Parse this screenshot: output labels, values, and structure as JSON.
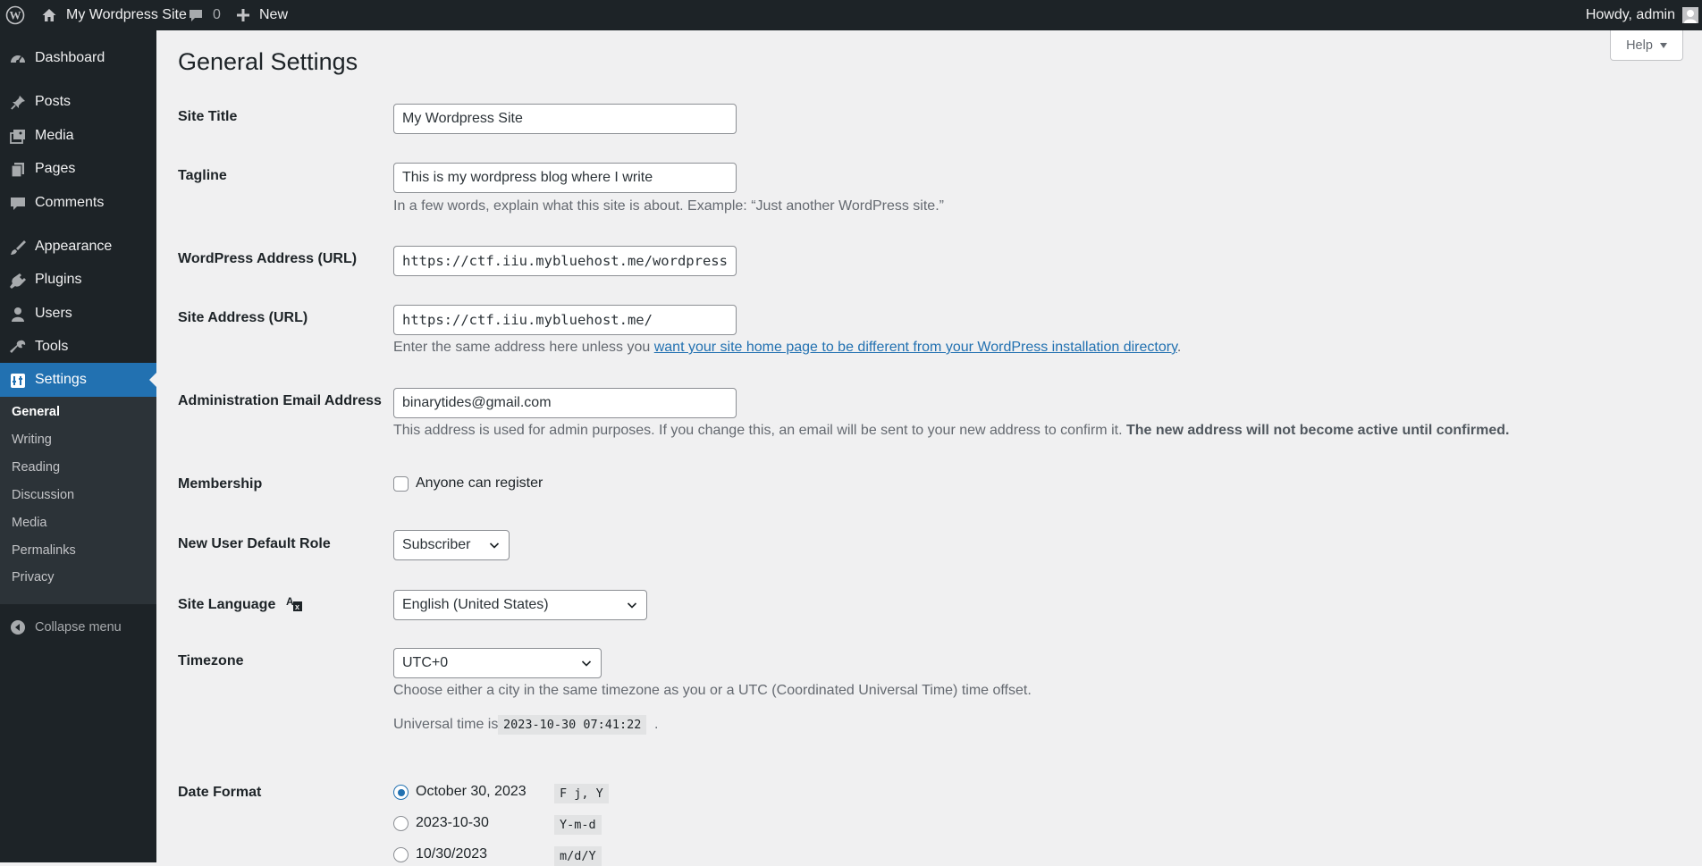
{
  "adminbar": {
    "site_name": "My Wordpress Site",
    "comments_count": "0",
    "new_label": "New",
    "howdy": "Howdy, admin"
  },
  "sidebar": {
    "items": [
      {
        "label": "Dashboard",
        "icon": "dashboard-icon"
      },
      {
        "label": "Posts",
        "icon": "pushpin-icon"
      },
      {
        "label": "Media",
        "icon": "media-icon"
      },
      {
        "label": "Pages",
        "icon": "pages-icon"
      },
      {
        "label": "Comments",
        "icon": "comments-icon"
      },
      {
        "label": "Appearance",
        "icon": "paintbrush-icon"
      },
      {
        "label": "Plugins",
        "icon": "plugin-icon"
      },
      {
        "label": "Users",
        "icon": "users-icon"
      },
      {
        "label": "Tools",
        "icon": "wrench-icon"
      },
      {
        "label": "Settings",
        "icon": "settings-icon"
      }
    ],
    "submenu": [
      "General",
      "Writing",
      "Reading",
      "Discussion",
      "Media",
      "Permalinks",
      "Privacy"
    ],
    "collapse_label": "Collapse menu",
    "accent": "#2271b1"
  },
  "help_label": "Help",
  "page_title": "General Settings",
  "settings": {
    "site_title": {
      "label": "Site Title",
      "value": "My Wordpress Site"
    },
    "tagline": {
      "label": "Tagline",
      "value": "This is my wordpress blog where I write",
      "desc": "In a few words, explain what this site is about. Example: “Just another WordPress site.”"
    },
    "wp_address": {
      "label": "WordPress Address (URL)",
      "value": "https://ctf.iiu.mybluehost.me/wordpress"
    },
    "site_address": {
      "label": "Site Address (URL)",
      "value": "https://ctf.iiu.mybluehost.me/",
      "desc_prefix": "Enter the same address here unless you ",
      "desc_link": "want your site home page to be different from your WordPress installation directory",
      "desc_suffix": "."
    },
    "admin_email": {
      "label": "Administration Email Address",
      "value": "binarytides@gmail.com",
      "desc": "This address is used for admin purposes. If you change this, an email will be sent to your new address to confirm it. ",
      "desc_bold": "The new address will not become active until confirmed."
    },
    "membership": {
      "label": "Membership",
      "checkbox_label": "Anyone can register",
      "checked": false
    },
    "default_role": {
      "label": "New User Default Role",
      "value": "Subscriber"
    },
    "site_language": {
      "label": "Site Language",
      "value": "English (United States)"
    },
    "timezone": {
      "label": "Timezone",
      "value": "UTC+0",
      "desc": "Choose either a city in the same timezone as you or a UTC (Coordinated Universal Time) time offset.",
      "universal_prefix": "Universal time is",
      "universal_time": "2023-10-30 07:41:22",
      "universal_suffix": "."
    },
    "date_format": {
      "label": "Date Format",
      "options": [
        {
          "label": "October 30, 2023",
          "code": "F j, Y",
          "checked": true
        },
        {
          "label": "2023-10-30",
          "code": "Y-m-d",
          "checked": false
        },
        {
          "label": "10/30/2023",
          "code": "m/d/Y",
          "checked": false
        }
      ]
    }
  }
}
